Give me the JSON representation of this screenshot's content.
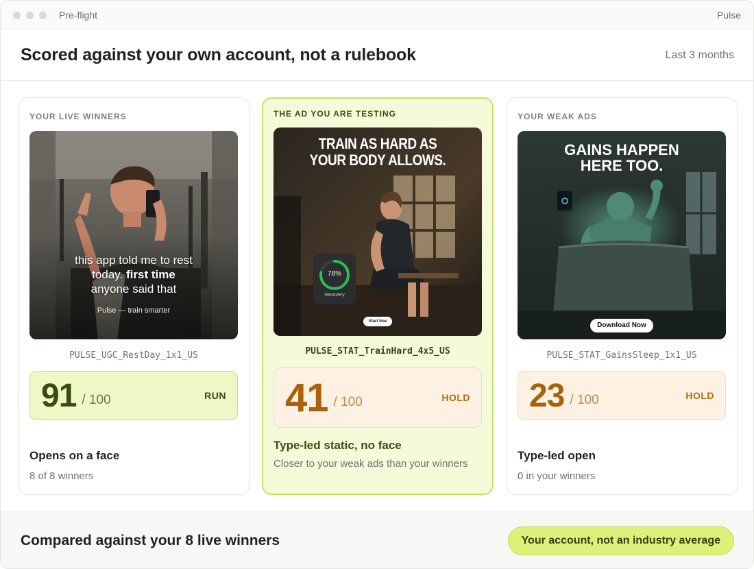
{
  "window": {
    "title": "Pre-flight",
    "app_name": "Pulse"
  },
  "header": {
    "title": "Scored against your own account, not a rulebook",
    "period": "Last 3 months"
  },
  "cards": [
    {
      "eyebrow": "YOUR LIVE WINNERS",
      "image": {
        "caption_line1": "this app told me to rest",
        "caption_line2_a": "today. ",
        "caption_line2_b": "first time",
        "caption_line3": "anyone said that",
        "brand": "Pulse — train smarter"
      },
      "ad_name": "PULSE_UGC_RestDay_1x1_US",
      "score": "91",
      "score_max": "/ 100",
      "verdict": "RUN",
      "insight_title": "Opens on a face",
      "insight_sub": "8 of 8 winners"
    },
    {
      "eyebrow": "THE AD YOU ARE TESTING",
      "image": {
        "headline_1": "TRAIN AS HARD AS",
        "headline_2": "YOUR BODY ALLOWS.",
        "widget_value": "78%",
        "widget_label": "Recovery",
        "cta": "Start free"
      },
      "ad_name": "PULSE_STAT_TrainHard_4x5_US",
      "score": "41",
      "score_max": "/ 100",
      "verdict": "HOLD",
      "insight_title": "Type-led static, no face",
      "insight_sub": "Closer to your weak ads than your winners"
    },
    {
      "eyebrow": "YOUR WEAK ADS",
      "image": {
        "headline_1": "GAINS HAPPEN",
        "headline_2": "HERE TOO.",
        "cta": "Download Now"
      },
      "ad_name": "PULSE_STAT_GainsSleep_1x1_US",
      "score": "23",
      "score_max": "/ 100",
      "verdict": "HOLD",
      "insight_title": "Type-led open",
      "insight_sub": "0 in your winners"
    }
  ],
  "footer": {
    "title": "Compared against your 8 live winners",
    "badge": "Your account, not an industry average"
  },
  "colors": {
    "accent": "#dcf07a",
    "run": "#3b4a10",
    "hold": "#a8620d",
    "highlight_bg": "#f3fbd8"
  }
}
